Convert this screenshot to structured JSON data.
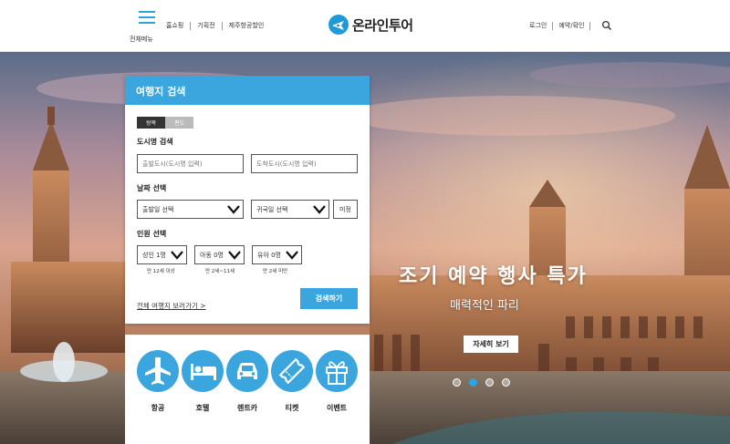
{
  "header": {
    "menu_label": "전체메뉴",
    "nav": [
      "홈쇼핑",
      "기획전",
      "제주항공할인"
    ],
    "logo_text": "온라인투어",
    "user_nav": [
      "로그인",
      "예약/확인"
    ]
  },
  "hero": {
    "title": "조기 예약 행사 특가",
    "subtitle": "매력적인 파리",
    "button": "자세히 보기",
    "slide_count": 4,
    "active_slide": 2
  },
  "search": {
    "title": "여행지 검색",
    "trip_types": [
      "왕복",
      "편도"
    ],
    "active_trip": "왕복",
    "city_label": "도시명 검색",
    "departure_placeholder": "출발도시(도시명 입력)",
    "arrival_placeholder": "도착도시(도시명 입력)",
    "date_label": "날짜 선택",
    "depart_date": "출발일 선택",
    "return_date": "귀국일 선택",
    "undecided": "미정",
    "people_label": "인원 선택",
    "adult": "성인 1명",
    "child": "아동 0명",
    "infant": "유아 0명",
    "adult_hint": "만 12세 이상",
    "child_hint": "만 2세~11세",
    "infant_hint": "만 2세 미만",
    "all_link": "전체 여행지 보러가기 >",
    "submit": "검색하기"
  },
  "categories": [
    {
      "label": "항공",
      "icon": "airplane-icon"
    },
    {
      "label": "호텔",
      "icon": "bed-icon"
    },
    {
      "label": "렌트카",
      "icon": "car-icon"
    },
    {
      "label": "티켓",
      "icon": "ticket-icon"
    },
    {
      "label": "이벤트",
      "icon": "gift-icon"
    }
  ],
  "colors": {
    "accent": "#3ba6dd",
    "logo": "#1e9ad6"
  }
}
